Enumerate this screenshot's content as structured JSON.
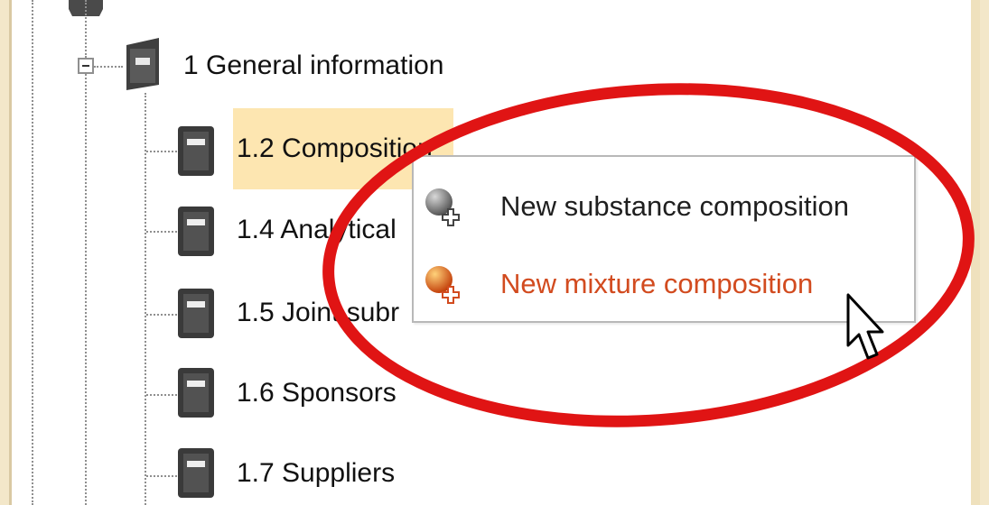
{
  "tree": {
    "root": {
      "label": "1 General information",
      "icon": "folder-icon"
    },
    "children": [
      {
        "label": "1.2 Composition",
        "selected": true
      },
      {
        "label": "1.4 Analytical"
      },
      {
        "label": "1.5 Joint subr"
      },
      {
        "label": "1.6 Sponsors"
      },
      {
        "label": "1.7 Suppliers"
      }
    ]
  },
  "context_menu": {
    "items": [
      {
        "label": "New substance composition",
        "icon": "gray-sphere-plus-icon",
        "color": "#1f1f1f"
      },
      {
        "label": "New mixture composition",
        "icon": "orange-sphere-plus-icon",
        "color": "#d24b1f"
      }
    ]
  },
  "annotation": {
    "color": "#e01414"
  }
}
